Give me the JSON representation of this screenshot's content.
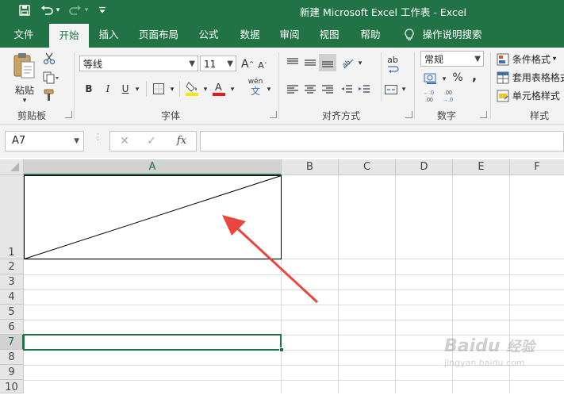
{
  "window": {
    "title": "新建 Microsoft Excel 工作表  -  Excel",
    "qat": {
      "save_icon": "save-icon",
      "undo_icon": "undo-icon",
      "redo_icon": "redo-icon",
      "customize_icon": "chevron-down-icon"
    }
  },
  "tabs": [
    {
      "label": "文件"
    },
    {
      "label": "开始"
    },
    {
      "label": "插入"
    },
    {
      "label": "页面布局"
    },
    {
      "label": "公式"
    },
    {
      "label": "数据"
    },
    {
      "label": "审阅"
    },
    {
      "label": "视图"
    },
    {
      "label": "帮助"
    },
    {
      "label": "操作说明搜索"
    }
  ],
  "active_tab": "开始",
  "ribbon": {
    "clipboard": {
      "paste_label": "粘贴",
      "group_label": "剪贴板"
    },
    "font": {
      "font_name": "等线",
      "font_size": "11",
      "bold": "B",
      "italic": "I",
      "underline": "U",
      "grow": "A",
      "shrink": "A",
      "phonetic_top": "wén",
      "phonetic_bottom": "文",
      "group_label": "字体",
      "font_color_hex": "#e31a1a",
      "fill_color_hex": "#ffe600"
    },
    "alignment": {
      "group_label": "对齐方式",
      "wrap_label": "ab"
    },
    "number": {
      "format": "常规",
      "percent": "%",
      "comma": ",",
      "inc_decimal": "+.0 .00",
      "dec_decimal": ".00 →.0",
      "group_label": "数字"
    },
    "styles": {
      "conditional": "条件格式",
      "table": "套用表格格式",
      "cell": "单元格样式",
      "group_label": "样式"
    }
  },
  "formula_bar": {
    "name_box": "A7",
    "cancel": "✕",
    "enter": "✓",
    "fx": "fx",
    "value": ""
  },
  "sheet": {
    "columns": [
      "A",
      "B",
      "C",
      "D",
      "E",
      "F"
    ],
    "rows": [
      "1",
      "2",
      "3",
      "4",
      "5",
      "6",
      "7",
      "8",
      "9",
      "10"
    ],
    "selected_column": "A",
    "selected_row": "7",
    "active_cell": "A7",
    "a1_content": "diagonal-border",
    "accent": "#217346",
    "annotation_arrow_color": "#e8463e"
  },
  "watermark": {
    "brand": "Baidu",
    "brand_cn": "经验",
    "url": "jingyan.baidu.com"
  }
}
